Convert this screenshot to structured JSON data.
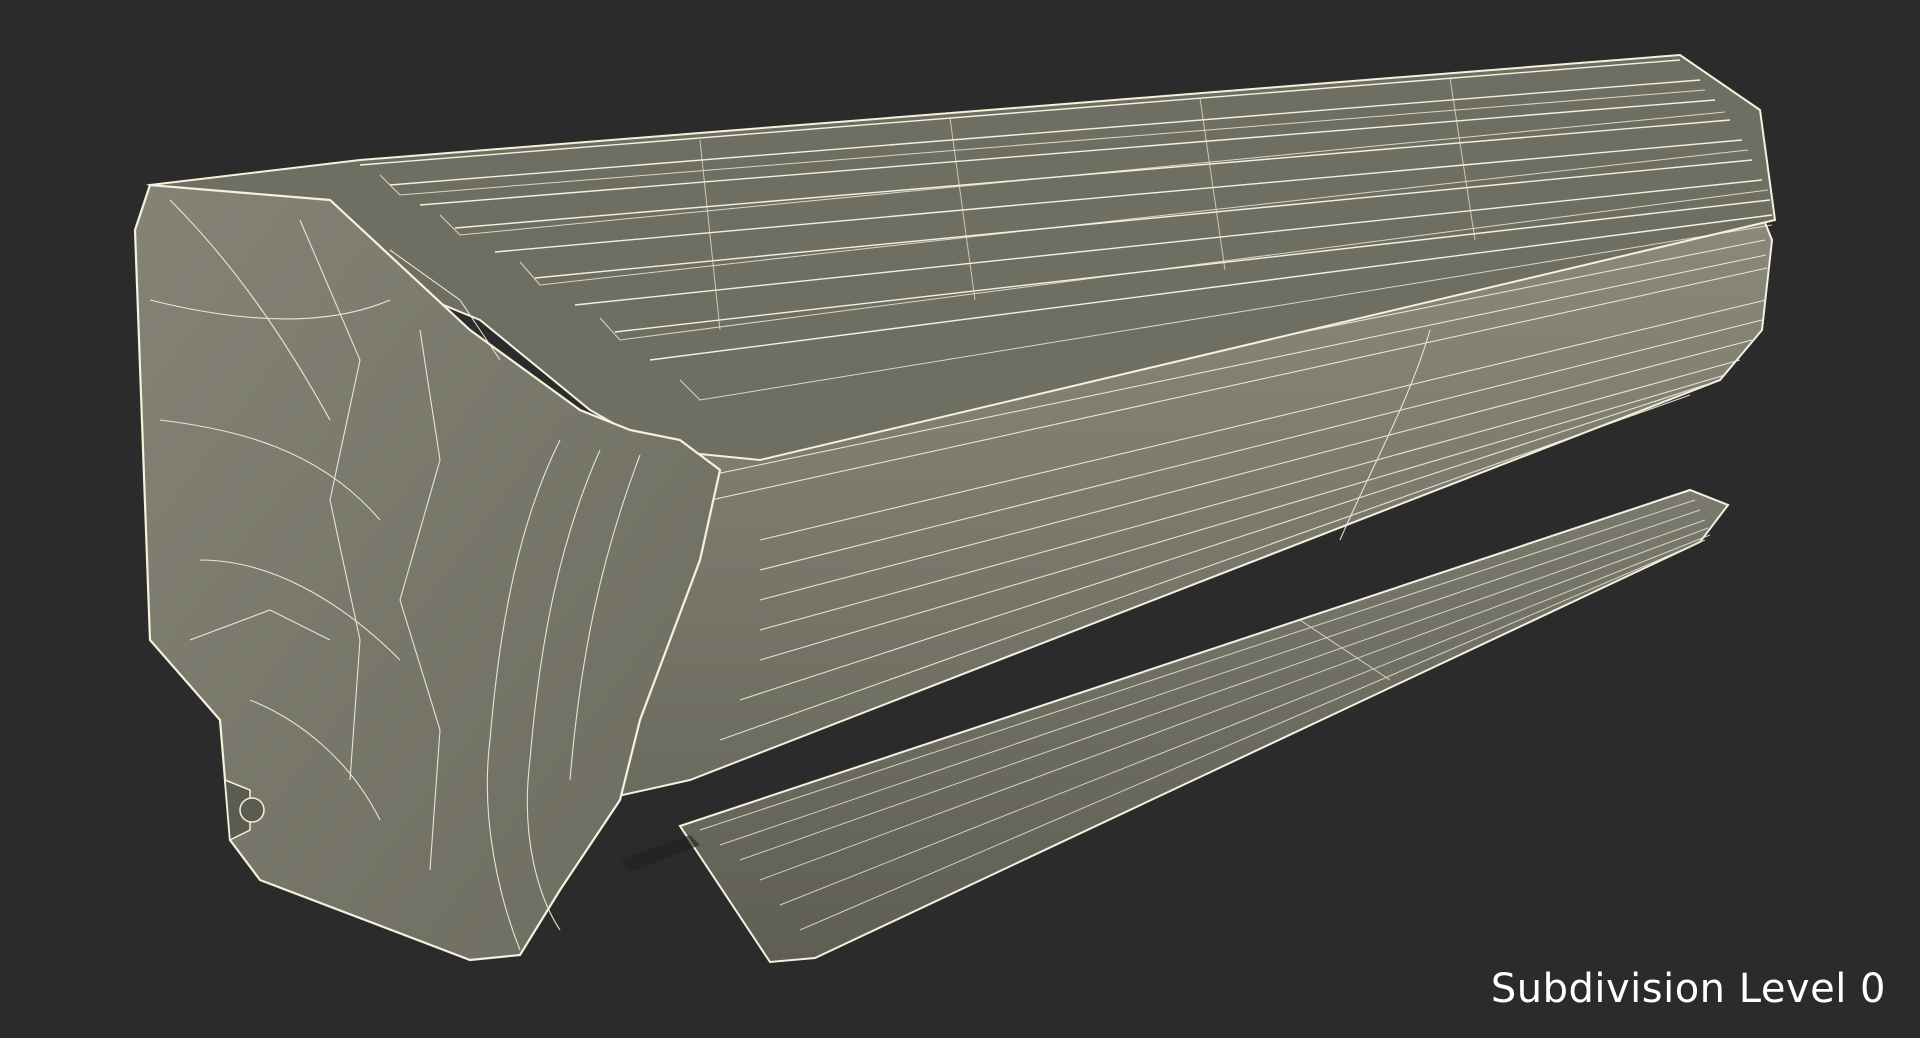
{
  "scene": {
    "object": "wall-mounted air conditioner wireframe render",
    "caption": "Subdivision Level 0",
    "colors": {
      "background": "#2b2b2b",
      "surface": "#7f7e70",
      "wire": "#f4f1dc",
      "caption": "#ffffff"
    }
  }
}
